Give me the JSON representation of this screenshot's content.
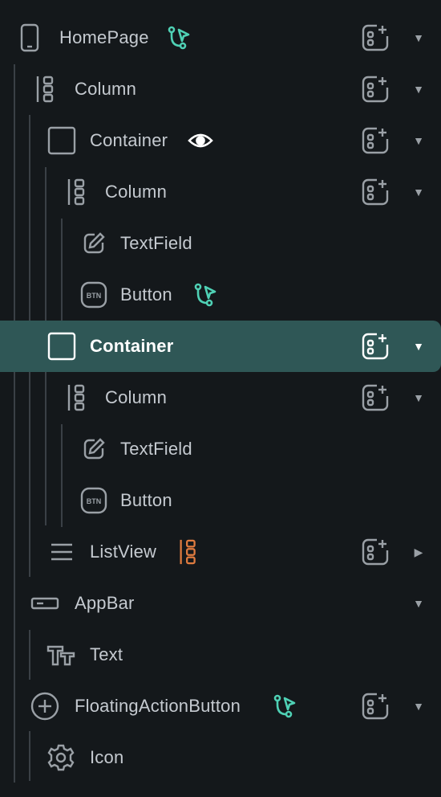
{
  "tree": {
    "nodes": [
      {
        "label": "HomePage",
        "icon": "phone-icon"
      },
      {
        "label": "Column",
        "icon": "column-icon"
      },
      {
        "label": "Container",
        "icon": "container-icon"
      },
      {
        "label": "Column",
        "icon": "column-icon"
      },
      {
        "label": "TextField",
        "icon": "edit-icon"
      },
      {
        "label": "Button",
        "icon": "button-icon",
        "icon_text": "BTN"
      },
      {
        "label": "Container",
        "icon": "container-icon",
        "selected": true
      },
      {
        "label": "Column",
        "icon": "column-icon"
      },
      {
        "label": "TextField",
        "icon": "edit-icon"
      },
      {
        "label": "Button",
        "icon": "button-icon",
        "icon_text": "BTN"
      },
      {
        "label": "ListView",
        "icon": "list-icon"
      },
      {
        "label": "AppBar",
        "icon": "appbar-icon"
      },
      {
        "label": "Text",
        "icon": "text-icon"
      },
      {
        "label": "FloatingActionButton",
        "icon": "plus-circle-icon"
      },
      {
        "label": "Icon",
        "icon": "settings-icon"
      }
    ]
  },
  "colors": {
    "background": "#14181b",
    "selected_row": "#2f5756",
    "action_badge": "#4fd1b5",
    "column_badge": "#e07b3f",
    "visibility_icon": "#ffffff",
    "text": "#c5cad0"
  }
}
